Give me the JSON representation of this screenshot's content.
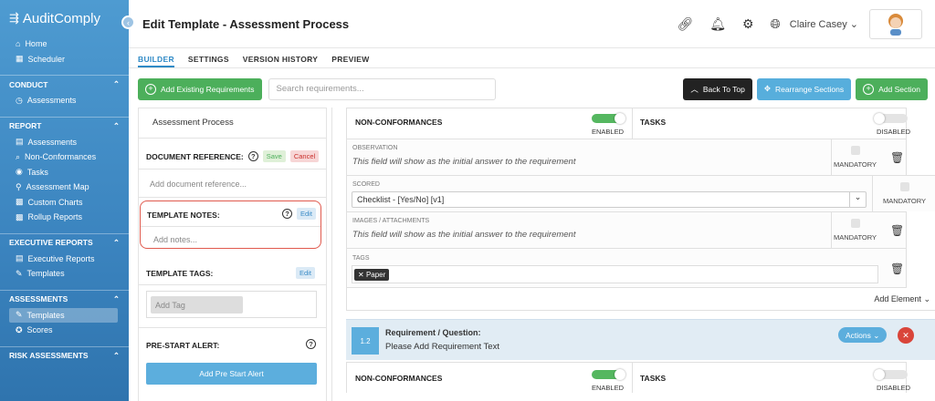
{
  "brand": {
    "name": "AuditComply"
  },
  "sidebar": {
    "top_items": [
      {
        "label": "Home"
      },
      {
        "label": "Scheduler"
      }
    ],
    "sections": [
      {
        "title": "CONDUCT",
        "items": [
          {
            "label": "Assessments"
          }
        ]
      },
      {
        "title": "REPORT",
        "items": [
          {
            "label": "Assessments"
          },
          {
            "label": "Non-Conformances"
          },
          {
            "label": "Tasks"
          },
          {
            "label": "Assessment Map"
          },
          {
            "label": "Custom Charts"
          },
          {
            "label": "Rollup Reports"
          }
        ]
      },
      {
        "title": "EXECUTIVE REPORTS",
        "items": [
          {
            "label": "Executive Reports"
          },
          {
            "label": "Templates"
          }
        ]
      },
      {
        "title": "ASSESSMENTS",
        "items": [
          {
            "label": "Templates"
          },
          {
            "label": "Scores"
          }
        ]
      },
      {
        "title": "RISK ASSESSMENTS"
      }
    ]
  },
  "header": {
    "title": "Edit Template - Assessment Process",
    "user": "Claire Casey"
  },
  "tabs": [
    {
      "label": "BUILDER"
    },
    {
      "label": "SETTINGS"
    },
    {
      "label": "VERSION HISTORY"
    },
    {
      "label": "PREVIEW"
    }
  ],
  "toolbar": {
    "add_existing": "Add Existing Requirements",
    "search_placeholder": "Search requirements...",
    "back_to_top": "Back To Top",
    "rearrange": "Rearrange Sections",
    "add_section": "Add Section"
  },
  "left": {
    "template_name": "Assessment Process",
    "doc_ref_label": "DOCUMENT REFERENCE:",
    "save": "Save",
    "cancel": "Cancel",
    "doc_ref_placeholder": "Add document reference...",
    "notes_label": "TEMPLATE NOTES:",
    "edit": "Edit",
    "notes_placeholder": "Add notes...",
    "tags_label": "TEMPLATE TAGS:",
    "tag_placeholder": "Add Tag",
    "alert_label": "PRE-START ALERT:",
    "alert_button": "Add Pre Start Alert"
  },
  "right": {
    "nonconf": "NON-CONFORMANCES",
    "tasks": "TASKS",
    "enabled": "ENABLED",
    "disabled": "DISABLED",
    "observation": "OBSERVATION",
    "initial_answer": "This field will show as the initial answer to the requirement",
    "mandatory": "MANDATORY",
    "scored": "SCORED",
    "scored_value": "Checklist - [Yes/No] [v1]",
    "images": "IMAGES / ATTACHMENTS",
    "tags": "TAGS",
    "tag_chip": "Paper",
    "add_element": "Add Element",
    "req_number": "1.2",
    "req_label": "Requirement / Question:",
    "req_text": "Please Add Requirement Text",
    "actions": "Actions"
  }
}
